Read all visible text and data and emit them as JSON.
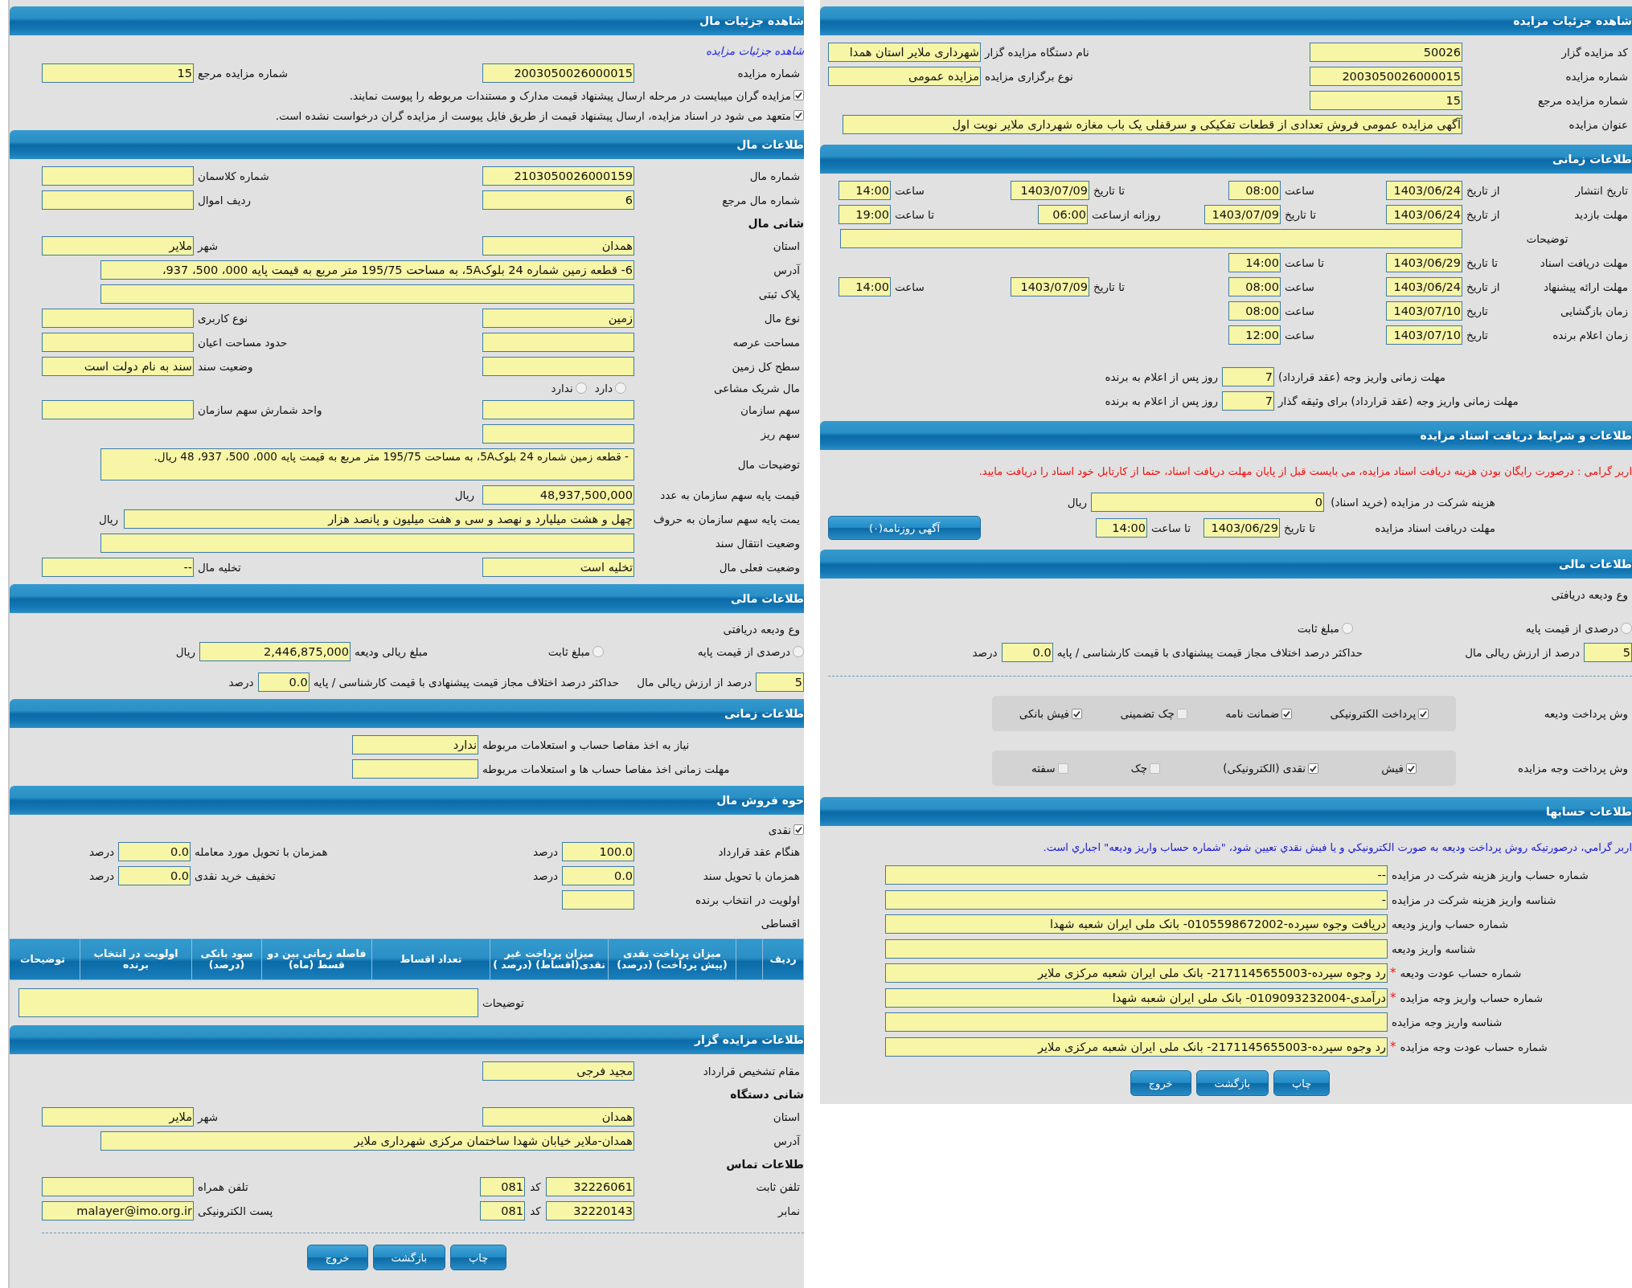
{
  "panels": [
    {
      "sections": [
        {
          "title": "شاهده جزئیات مزایده",
          "rows": [
            {
              "kind": "pair",
              "cells": [
                {
                  "kind": "label",
                  "text": "کد مزایده گزار"
                },
                {
                  "kind": "field",
                  "value": "50026"
                },
                {
                  "kind": "label",
                  "text": "نام دستگاه مزایده گزار"
                },
                {
                  "kind": "field",
                  "value": "شهرداری ملایر استان همدا"
                }
              ]
            },
            {
              "kind": "pair",
              "cells": [
                {
                  "kind": "label",
                  "text": "شماره مزایده"
                },
                {
                  "kind": "field",
                  "value": "2003050026000015"
                },
                {
                  "kind": "label",
                  "text": "نوع برگزاری مزایده"
                },
                {
                  "kind": "field",
                  "value": "مزایده عمومی"
                }
              ]
            },
            {
              "kind": "pair",
              "cells": [
                {
                  "kind": "label",
                  "text": "شماره مزایده مرجع"
                },
                {
                  "kind": "field",
                  "value": "15"
                }
              ]
            },
            {
              "kind": "wide",
              "cells": [
                {
                  "kind": "label",
                  "text": "عنوان مزایده"
                },
                {
                  "kind": "field",
                  "value": "آگهی مزایده عمومی فروش تعدادی از قطعات تفکیکی و سرقفلی یک باب مغازه شهرداری ملایر نوبت اول"
                }
              ]
            }
          ]
        },
        {
          "title": "طلاعات زمانی",
          "rows": [
            {
              "kind": "time",
              "cells": [
                {
                  "kind": "label",
                  "text": "تاریخ انتشار"
                },
                {
                  "kind": "label",
                  "text": "از تاریخ"
                },
                {
                  "kind": "field",
                  "value": "1403/06/24"
                },
                {
                  "kind": "label",
                  "text": "ساعت"
                },
                {
                  "kind": "field",
                  "value": "08:00"
                },
                {
                  "kind": "label",
                  "text": "تا تاریخ"
                },
                {
                  "kind": "field",
                  "value": "1403/07/09"
                },
                {
                  "kind": "label",
                  "text": "ساعت"
                },
                {
                  "kind": "field",
                  "value": "14:00"
                }
              ]
            },
            {
              "kind": "visit",
              "cells": [
                {
                  "kind": "label",
                  "text": "مهلت بازدید"
                },
                {
                  "kind": "label",
                  "text": "از تاریخ"
                },
                {
                  "kind": "field",
                  "value": "1403/06/24"
                },
                {
                  "kind": "label",
                  "text": "تا تاریخ"
                },
                {
                  "kind": "field",
                  "value": "1403/07/09"
                },
                {
                  "kind": "label",
                  "text": "روزانه ازساعت"
                },
                {
                  "kind": "field",
                  "value": "06:00"
                },
                {
                  "kind": "label",
                  "text": "تا ساعت"
                },
                {
                  "kind": "field",
                  "value": "19:00"
                }
              ]
            },
            {
              "kind": "timewide",
              "cells": [
                {
                  "kind": "label",
                  "text": "توضیحات"
                },
                {
                  "kind": "field"
                }
              ]
            },
            {
              "kind": "time",
              "cells": [
                {
                  "kind": "label",
                  "text": "مهلت دریافت اسناد"
                },
                {
                  "kind": "label",
                  "text": "تا تاریخ"
                },
                {
                  "kind": "field",
                  "value": "1403/06/29"
                },
                {
                  "kind": "label",
                  "text": "تا ساعت"
                },
                {
                  "kind": "field",
                  "value": "14:00"
                }
              ]
            },
            {
              "kind": "time",
              "cells": [
                {
                  "kind": "label",
                  "text": "مهلت ارائه پیشنهاد"
                },
                {
                  "kind": "label",
                  "text": "از تاریخ"
                },
                {
                  "kind": "field",
                  "value": "1403/06/24"
                },
                {
                  "kind": "label",
                  "text": "ساعت"
                },
                {
                  "kind": "field",
                  "value": "08:00"
                },
                {
                  "kind": "label",
                  "text": "تا تاریخ"
                },
                {
                  "kind": "field",
                  "value": "1403/07/09"
                },
                {
                  "kind": "label",
                  "text": "ساعت"
                },
                {
                  "kind": "field",
                  "value": "14:00"
                }
              ]
            },
            {
              "kind": "time",
              "cells": [
                {
                  "kind": "label",
                  "text": "زمان بازگشایی"
                },
                {
                  "kind": "label",
                  "text": "تاریخ"
                },
                {
                  "kind": "field",
                  "value": "1403/07/10"
                },
                {
                  "kind": "label",
                  "text": "ساعت"
                },
                {
                  "kind": "field",
                  "value": "08:00"
                }
              ]
            },
            {
              "kind": "time",
              "cells": [
                {
                  "kind": "label",
                  "text": "زمان اعلام برنده"
                },
                {
                  "kind": "label",
                  "text": "تاریخ"
                },
                {
                  "kind": "field",
                  "value": "1403/07/10"
                },
                {
                  "kind": "label",
                  "text": "ساعت"
                },
                {
                  "kind": "field",
                  "value": "12:00"
                }
              ]
            },
            {
              "kind": "days",
              "cells": [
                {
                  "kind": "label",
                  "text": "مهلت زمانی واریز وجه (عقد قرارداد)"
                },
                {
                  "kind": "field",
                  "value": "7"
                },
                {
                  "kind": "unit",
                  "text": "روز پس از اعلام به برنده"
                }
              ]
            },
            {
              "kind": "days",
              "cells": [
                {
                  "kind": "label",
                  "text": "مهلت زمانی واریز وجه (عقد قرارداد) برای وثیقه گذار"
                },
                {
                  "kind": "field",
                  "value": "7"
                },
                {
                  "kind": "unit",
                  "text": "روز پس از اعلام به برنده"
                }
              ]
            }
          ]
        },
        {
          "title": "طلاعات و شرایط دریافت اسناد مزایده",
          "rows": [
            {
              "kind": "message",
              "cells": [
                {
                  "kind": "warning",
                  "text": "اربر گرامی : درصورت رایگان بودن هزینه دریافت اسناد مزایده، می بایست قبل از پایان مهلت دریافت اسناد، حتما از کارتابل خود اسناد را دریافت مایید."
                }
              ]
            },
            {
              "kind": "fee",
              "cells": [
                {
                  "kind": "label",
                  "text": "هزینه شرکت در مزایده (خرید اسناد)"
                },
                {
                  "kind": "field",
                  "value": "0"
                },
                {
                  "kind": "unit",
                  "text": "ریال"
                }
              ]
            },
            {
              "kind": "docs",
              "cells": [
                {
                  "kind": "label",
                  "text": "مهلت دریافت اسناد مزایده"
                },
                {
                  "kind": "label",
                  "text": "تا تاریخ"
                },
                {
                  "kind": "field",
                  "value": "1403/06/29"
                },
                {
                  "kind": "label",
                  "text": "تا ساعت"
                },
                {
                  "kind": "field",
                  "value": "14:00"
                },
                {
                  "kind": "button",
                  "text": "آگهی روزنامه(۰)"
                }
              ]
            }
          ]
        },
        {
          "title": "طلاعات مالی",
          "rows": [
            {
              "kind": "text",
              "cells": [
                {
                  "kind": "text",
                  "text": "وع ودیعه دریافتی"
                }
              ]
            },
            {
              "kind": "basis",
              "cells": [
                {
                  "kind": "radio",
                  "text": "درصدی از قیمت پایه",
                  "selected": false
                },
                {
                  "kind": "radio",
                  "text": "مبلغ ثابت",
                  "selected": false
                }
              ]
            },
            {
              "kind": "percent",
              "cells": [
                {
                  "kind": "field",
                  "value": "5"
                },
                {
                  "kind": "unit",
                  "text": "درصد از ارزش ریالی مال"
                },
                {
                  "kind": "label",
                  "text": "حداکثر درصد اختلاف مجاز قیمت پیشنهادی با قیمت کارشناسی / پایه"
                },
                {
                  "kind": "field",
                  "value": "0.0"
                },
                {
                  "kind": "unit",
                  "text": "درصد"
                }
              ]
            },
            {
              "kind": "divider"
            },
            {
              "kind": "payopts",
              "cells": [
                {
                  "kind": "label",
                  "text": "وش پرداخت ودیعه"
                },
                {
                  "kind": "group",
                  "items": [
                    {
                      "text": "پرداخت الکترونیکی",
                      "checked": true
                    },
                    {
                      "text": "ضمانت نامه",
                      "checked": true
                    },
                    {
                      "text": "چک تضمینی",
                      "checked": false
                    },
                    {
                      "text": "فیش بانکی",
                      "checked": true
                    }
                  ]
                }
              ]
            },
            {
              "kind": "payopts",
              "cells": [
                {
                  "kind": "label",
                  "text": "وش پرداخت وجه مزایده"
                },
                {
                  "kind": "group",
                  "items": [
                    {
                      "text": "فیش",
                      "checked": true
                    },
                    {
                      "text": "نقدی (الکترونیکی)",
                      "checked": true
                    },
                    {
                      "text": "چک",
                      "checked": false
                    },
                    {
                      "text": "سفته",
                      "checked": false
                    }
                  ]
                }
              ]
            }
          ]
        },
        {
          "title": "طلاعات حسابها",
          "rows": [
            {
              "kind": "message",
              "cells": [
                {
                  "kind": "note",
                  "text": "اربر گرامي، درصورتيکه روش پرداخت وديعه به صورت الکترونيکي و يا فيش نقدي تعيين شود، \"شماره حساب واريز وديعه\" اجباري است."
                }
              ]
            },
            {
              "kind": "account",
              "cells": [
                {
                  "kind": "label",
                  "text": "شماره حساب واریز هزینه شرکت در مزایده"
                },
                {
                  "kind": "field",
                  "value": "--"
                }
              ]
            },
            {
              "kind": "account",
              "cells": [
                {
                  "kind": "label",
                  "text": "شناسه واریز هزینه شرکت در مزایده"
                },
                {
                  "kind": "field",
                  "value": "-"
                }
              ]
            },
            {
              "kind": "account",
              "cells": [
                {
                  "kind": "label",
                  "text": "شماره حساب واریز ودیعه"
                },
                {
                  "kind": "field",
                  "value": "دریافت وجوه سپرده-0105598672002- بانک ملی ایران شعبه شهدا"
                }
              ]
            },
            {
              "kind": "account",
              "cells": [
                {
                  "kind": "label",
                  "text": "شناسه واریز ودیعه"
                },
                {
                  "kind": "field"
                }
              ]
            },
            {
              "kind": "account",
              "cells": [
                {
                  "kind": "label",
                  "text": "شماره حساب عودت ودیعه",
                  "mark": "*"
                },
                {
                  "kind": "field",
                  "value": "رد وجوه سپرده-2171145655003- بانک ملی ایران شعبه مرکزی ملایر"
                }
              ]
            },
            {
              "kind": "account",
              "cells": [
                {
                  "kind": "label",
                  "text": "شماره حساب واریز وجه مزایده",
                  "mark": "*"
                },
                {
                  "kind": "field",
                  "value": "درآمدی-0109093232004- بانک ملی ایران شعبه شهدا"
                }
              ]
            },
            {
              "kind": "account",
              "cells": [
                {
                  "kind": "label",
                  "text": "شناسه واریز وجه مزایده"
                },
                {
                  "kind": "field"
                }
              ]
            },
            {
              "kind": "account",
              "cells": [
                {
                  "kind": "label",
                  "text": "شماره حساب عودت وجه مزایده",
                  "mark": "*"
                },
                {
                  "kind": "field",
                  "value": "رد وجوه سپرده-2171145655003- بانک ملی ایران شعبه مرکزی ملایر"
                }
              ]
            },
            {
              "kind": "buttons",
              "cells": [
                {
                  "kind": "button",
                  "text": "چاپ"
                },
                {
                  "kind": "button",
                  "text": "بازگشت"
                },
                {
                  "kind": "button",
                  "text": "خروج"
                }
              ]
            }
          ]
        }
      ]
    },
    {
      "sections": [
        {
          "title": "شاهده جزئیات مال",
          "rows": [
            {
              "kind": "link",
              "cells": [
                {
                  "kind": "link",
                  "text": "شاهده جزئیات مزایده"
                }
              ]
            },
            {
              "kind": "pair",
              "cells": [
                {
                  "kind": "label",
                  "text": "شماره مزایده"
                },
                {
                  "kind": "field",
                  "value": "2003050026000015"
                },
                {
                  "kind": "label",
                  "text": "شماره مزایده مرجع"
                },
                {
                  "kind": "field",
                  "value": "15"
                }
              ]
            },
            {
              "kind": "check",
              "cells": [
                {
                  "kind": "check",
                  "text": "مزایده گران میبایست در مرحله ارسال پیشنهاد قیمت مدارک و مستندات مربوطه را پیوست نمایند.",
                  "checked": true
                }
              ]
            },
            {
              "kind": "check",
              "cells": [
                {
                  "kind": "check",
                  "text": "متعهد می شود در اسناد مزایده، ارسال پیشنهاد قیمت از طریق فایل پیوست از مزایده گران درخواست نشده است.",
                  "checked": true
                }
              ]
            }
          ]
        },
        {
          "title": "طلاعات مال",
          "rows": [
            {
              "kind": "pair",
              "cells": [
                {
                  "kind": "label",
                  "text": "شماره مال"
                },
                {
                  "kind": "field",
                  "value": "2103050026000159"
                },
                {
                  "kind": "label",
                  "text": "شماره کلاسمان"
                },
                {
                  "kind": "field"
                }
              ]
            },
            {
              "kind": "pair",
              "cells": [
                {
                  "kind": "label",
                  "text": "شماره مال مرجع"
                },
                {
                  "kind": "field",
                  "value": "6"
                },
                {
                  "kind": "label",
                  "text": "ردیف اموال"
                },
                {
                  "kind": "field"
                }
              ]
            },
            {
              "kind": "subhead",
              "cells": [
                {
                  "kind": "subhead",
                  "text": "شانی مال"
                }
              ]
            },
            {
              "kind": "pair",
              "cells": [
                {
                  "kind": "label",
                  "text": "استان"
                },
                {
                  "kind": "field",
                  "value": "همدان"
                },
                {
                  "kind": "label",
                  "text": "شهر"
                },
                {
                  "kind": "field",
                  "value": "ملایر"
                }
              ]
            },
            {
              "kind": "wide",
              "cells": [
                {
                  "kind": "label",
                  "text": "آدرس"
                },
                {
                  "kind": "field",
                  "value": "6-   قطعه زمین شماره 24 بلوک5A،   به مساحت 195/75 متر مربع به قیمت پایه 000، 500، 937،"
                }
              ]
            },
            {
              "kind": "wide",
              "cells": [
                {
                  "kind": "label",
                  "text": "پلاک ثبتی"
                },
                {
                  "kind": "field"
                }
              ]
            },
            {
              "kind": "pair",
              "cells": [
                {
                  "kind": "label",
                  "text": "نوع مال"
                },
                {
                  "kind": "field",
                  "value": "زمین"
                },
                {
                  "kind": "label",
                  "text": "نوع کاربری"
                },
                {
                  "kind": "field"
                }
              ]
            },
            {
              "kind": "pair",
              "cells": [
                {
                  "kind": "label",
                  "text": "مساحت عرصه"
                },
                {
                  "kind": "field"
                },
                {
                  "kind": "label",
                  "text": "حدود مساحت اعیان"
                },
                {
                  "kind": "field"
                }
              ]
            },
            {
              "kind": "pair",
              "cells": [
                {
                  "kind": "label",
                  "text": "سطح کل زمین"
                },
                {
                  "kind": "field"
                },
                {
                  "kind": "label",
                  "text": "وضعیت سند"
                },
                {
                  "kind": "field",
                  "value": "سند به نام دولت است"
                }
              ]
            },
            {
              "kind": "share",
              "cells": [
                {
                  "kind": "label",
                  "text": "مال شریک مشاعی"
                },
                {
                  "kind": "radio",
                  "text": "دارد",
                  "selected": false
                },
                {
                  "kind": "radio",
                  "text": "ندارد",
                  "selected": false
                }
              ]
            },
            {
              "kind": "pair",
              "cells": [
                {
                  "kind": "label",
                  "text": "سهم سازمان"
                },
                {
                  "kind": "field"
                },
                {
                  "kind": "label",
                  "text": "واحد شمارش سهم سازمان"
                },
                {
                  "kind": "field"
                }
              ]
            },
            {
              "kind": "pair",
              "cells": [
                {
                  "kind": "label",
                  "text": "سهم ریز"
                },
                {
                  "kind": "field"
                }
              ]
            },
            {
              "kind": "area",
              "cells": [
                {
                  "kind": "label",
                  "text": "توضیحات مال"
                },
                {
                  "kind": "area",
                  "value": "-   قطعه زمین شماره 24 بلوک5A،   به مساحت 195/75 متر مربع به قیمت پایه 000، 500، 937، 48 ریال."
                }
              ]
            },
            {
              "kind": "money",
              "cells": [
                {
                  "kind": "label",
                  "text": "قیمت پایه سهم سازمان به عدد"
                },
                {
                  "kind": "field",
                  "value": "48,937,500,000"
                },
                {
                  "kind": "unit",
                  "text": "ریال"
                }
              ]
            },
            {
              "kind": "wideunit",
              "cells": [
                {
                  "kind": "label",
                  "text": "یمت پایه سهم سازمان به حروف"
                },
                {
                  "kind": "field",
                  "value": "چهل و هشت میلیارد و نهصد و سی و هفت میلیون و پانصد هزار"
                },
                {
                  "kind": "unit",
                  "text": "ریال"
                }
              ]
            },
            {
              "kind": "wide",
              "cells": [
                {
                  "kind": "label",
                  "text": "وضعیت انتقال سند"
                },
                {
                  "kind": "field"
                }
              ]
            },
            {
              "kind": "pair",
              "cells": [
                {
                  "kind": "label",
                  "text": "وضعیت فعلی مال"
                },
                {
                  "kind": "field",
                  "value": "تخلیه است"
                },
                {
                  "kind": "label",
                  "text": "تخلیه مال"
                },
                {
                  "kind": "field",
                  "value": "--"
                }
              ]
            }
          ]
        },
        {
          "title": "طلاعات مالی",
          "rows": [
            {
              "kind": "text",
              "cells": [
                {
                  "kind": "text",
                  "text": "وع ودیعه دریافتی"
                }
              ]
            },
            {
              "kind": "deposit",
              "options": [
                {
                  "text": "درصدی از قیمت پایه",
                  "selected": false
                },
                {
                  "text": "مبلغ ثابت",
                  "selected": false
                }
              ],
              "amount": {
                "label": "مبلغ ریالی ودیعه",
                "value": "2,446,875,000",
                "unit": "ریال"
              }
            },
            {
              "kind": "percent",
              "cells": [
                {
                  "kind": "field",
                  "value": "5"
                },
                {
                  "kind": "unit",
                  "text": "درصد از ارزش ریالی مال"
                },
                {
                  "kind": "label",
                  "text": "حداکثر درصد اختلاف مجاز قیمت پیشنهادی با قیمت کارشناسی / پایه"
                },
                {
                  "kind": "field",
                  "value": "0.0"
                },
                {
                  "kind": "unit",
                  "text": "درصد"
                }
              ]
            }
          ]
        },
        {
          "title": "طلاعات زمانی",
          "rows": [
            {
              "kind": "clearance",
              "cells": [
                {
                  "kind": "label",
                  "text": "نیاز به اخذ مفاصا حساب و استعلامات مربوطه"
                },
                {
                  "kind": "field",
                  "value": "ندارد"
                }
              ]
            },
            {
              "kind": "clearance",
              "cells": [
                {
                  "kind": "label",
                  "text": "مهلت زمانی اخذ مفاصا حساب ها و استعلامات مربوطه"
                },
                {
                  "kind": "field"
                }
              ]
            }
          ]
        },
        {
          "title": "حوه فروش مال",
          "rows": [
            {
              "kind": "check",
              "cells": [
                {
                  "kind": "check",
                  "text": "نقدی",
                  "checked": true
                }
              ]
            },
            {
              "kind": "sale",
              "cells": [
                {
                  "kind": "label",
                  "text": "هنگام عقد قرارداد"
                },
                {
                  "kind": "field",
                  "value": "100.0"
                },
                {
                  "kind": "unit",
                  "text": "درصد"
                },
                {
                  "kind": "label",
                  "text": "همزمان با تحویل مورد معامله"
                },
                {
                  "kind": "field",
                  "value": "0.0"
                },
                {
                  "kind": "unit",
                  "text": "درصد"
                }
              ]
            },
            {
              "kind": "sale",
              "cells": [
                {
                  "kind": "label",
                  "text": "همزمان با تحویل سند"
                },
                {
                  "kind": "field",
                  "value": "0.0"
                },
                {
                  "kind": "unit",
                  "text": "درصد"
                },
                {
                  "kind": "label",
                  "text": "تخفیف خرید نقدی"
                },
                {
                  "kind": "field",
                  "value": "0.0"
                },
                {
                  "kind": "unit",
                  "text": "درصد"
                }
              ]
            },
            {
              "kind": "sale",
              "cells": [
                {
                  "kind": "label",
                  "text": "اولویت در انتخاب برنده"
                },
                {
                  "kind": "field"
                }
              ]
            },
            {
              "kind": "text",
              "cells": [
                {
                  "kind": "text",
                  "text": "اقساطی"
                }
              ]
            },
            {
              "kind": "table",
              "columns": [
                {
                  "kind": "heading",
                  "text": "ردیف"
                },
                {
                  "kind": "blank"
                },
                {
                  "kind": "heading",
                  "text": "میزان پرداخت نقدی (پیش پرداخت) (درصد)"
                },
                {
                  "kind": "heading",
                  "text": "میزان پرداخت غیر نقدی(اقساط) (درصد )"
                },
                {
                  "kind": "heading",
                  "text": "تعداد اقساط"
                },
                {
                  "kind": "heading",
                  "text": "فاصله زمانی بین دو قسط (ماه)"
                },
                {
                  "kind": "heading",
                  "text": "سود بانکی (درصد)"
                },
                {
                  "kind": "heading",
                  "text": "اولویت در انتخاب برنده"
                },
                {
                  "kind": "heading",
                  "text": "توضیحات"
                }
              ]
            },
            {
              "kind": "remarks",
              "cells": [
                {
                  "kind": "label",
                  "text": "توضیحات"
                },
                {
                  "kind": "area"
                }
              ]
            }
          ]
        },
        {
          "title": "طلاعات مزایده گزار",
          "rows": [
            {
              "kind": "pair",
              "cells": [
                {
                  "kind": "label",
                  "text": "مقام تشخیص قرارداد"
                },
                {
                  "kind": "field",
                  "value": "مجید فرجی"
                }
              ]
            },
            {
              "kind": "subhead",
              "cells": [
                {
                  "kind": "subhead",
                  "text": "شانی دستگاه"
                }
              ]
            },
            {
              "kind": "pair",
              "cells": [
                {
                  "kind": "label",
                  "text": "استان"
                },
                {
                  "kind": "field",
                  "value": "همدان"
                },
                {
                  "kind": "label",
                  "text": "شهر"
                },
                {
                  "kind": "field",
                  "value": "ملایر"
                }
              ]
            },
            {
              "kind": "wide",
              "cells": [
                {
                  "kind": "label",
                  "text": "آدرس"
                },
                {
                  "kind": "field",
                  "value": "همدان-ملایر خیابان شهدا ساختمان مرکزی شهرداری ملایر"
                }
              ]
            },
            {
              "kind": "subhead",
              "cells": [
                {
                  "kind": "subhead",
                  "text": "طلاعات تماس"
                }
              ]
            },
            {
              "kind": "phone",
              "cells": [
                {
                  "kind": "label",
                  "text": "تلفن ثابت"
                },
                {
                  "kind": "field",
                  "value": "32226061"
                },
                {
                  "kind": "label",
                  "text": "کد"
                },
                {
                  "kind": "field",
                  "value": "081"
                },
                {
                  "kind": "label",
                  "text": "تلفن همراه"
                },
                {
                  "kind": "field"
                }
              ]
            },
            {
              "kind": "phone",
              "cells": [
                {
                  "kind": "label",
                  "text": "نمابر"
                },
                {
                  "kind": "field",
                  "value": "32220143"
                },
                {
                  "kind": "label",
                  "text": "کد"
                },
                {
                  "kind": "field",
                  "value": "081"
                },
                {
                  "kind": "label",
                  "text": "پست الکترونیکی"
                },
                {
                  "kind": "field",
                  "value": "malayer@imo.org.ir"
                }
              ]
            },
            {
              "kind": "divider"
            },
            {
              "kind": "buttons",
              "cells": [
                {
                  "kind": "button",
                  "text": "چاپ"
                },
                {
                  "kind": "button",
                  "text": "بازگشت"
                },
                {
                  "kind": "button",
                  "text": "خروج"
                }
              ]
            }
          ]
        }
      ]
    }
  ]
}
